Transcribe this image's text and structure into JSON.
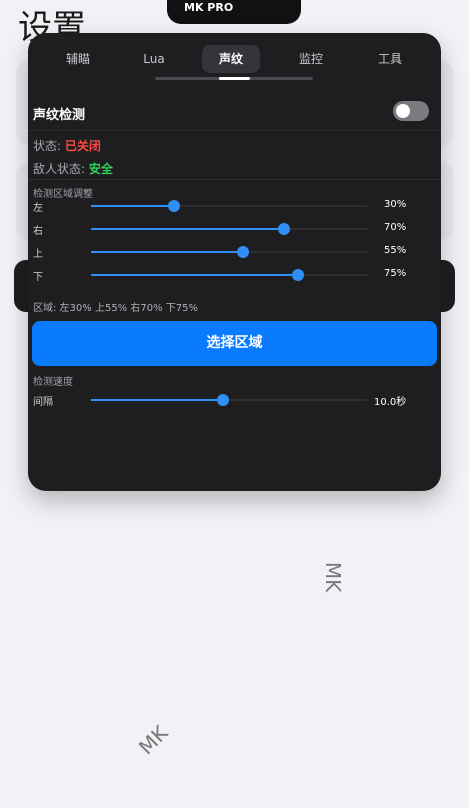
{
  "background": {
    "page_title": "设置",
    "watermark_1": "MK",
    "watermark_2": "MK"
  },
  "notch": {
    "title": "MK PRO"
  },
  "tabs": [
    {
      "label": "辅瞄",
      "active": false
    },
    {
      "label": "Lua",
      "active": false
    },
    {
      "label": "声纹",
      "active": true
    },
    {
      "label": "监控",
      "active": false
    },
    {
      "label": "工具",
      "active": false
    }
  ],
  "voiceprint": {
    "title": "声纹检测",
    "toggle_on": false,
    "status_label": "状态:",
    "status_value": "已关闭",
    "enemy_label": "敌人状态:",
    "enemy_value": "安全"
  },
  "region": {
    "section_title": "检测区域调整",
    "sliders": [
      {
        "label": "左",
        "value": 30,
        "display": "30%"
      },
      {
        "label": "右",
        "value": 70,
        "display": "70%"
      },
      {
        "label": "上",
        "value": 55,
        "display": "55%"
      },
      {
        "label": "下",
        "value": 75,
        "display": "75%"
      }
    ],
    "summary": "区域: 左30% 上55% 右70% 下75%",
    "select_button": "选择区域"
  },
  "speed": {
    "section_title": "检测速度",
    "interval_label": "间隔",
    "interval_fraction": 0.48,
    "interval_display": "10.0秒"
  },
  "colors": {
    "accent": "#2f8ff5",
    "button": "#0a7bff",
    "status_off": "#ff4a45",
    "safe": "#2fd15a",
    "panel": "#1e1e21"
  }
}
